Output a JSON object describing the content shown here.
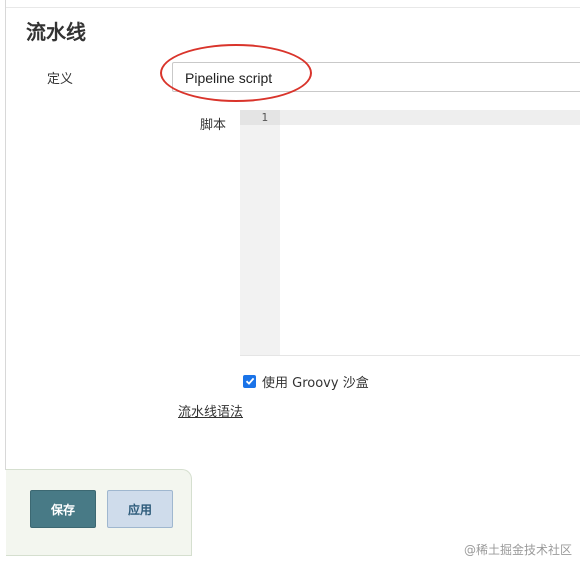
{
  "section": {
    "title": "流水线"
  },
  "definition": {
    "label": "定义",
    "selected": "Pipeline script"
  },
  "script": {
    "label": "脚本",
    "line_numbers": [
      "1"
    ]
  },
  "sandbox": {
    "label": "使用 Groovy 沙盒",
    "checked": true
  },
  "links": {
    "syntax": "流水线语法"
  },
  "buttons": {
    "save": "保存",
    "apply": "应用"
  },
  "watermark": "@稀土掘金技术社区",
  "colors": {
    "annotation": "#d9342b",
    "save_bg": "#487a86",
    "apply_bg": "#cfdceb",
    "checkbox": "#1a73e8"
  }
}
